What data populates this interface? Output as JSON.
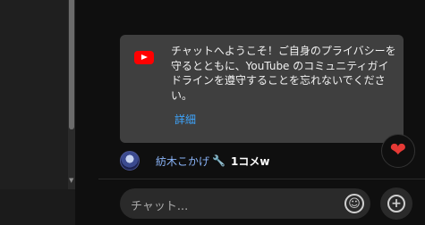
{
  "welcome": {
    "message": "チャットへようこそ！ご自身のプライバシーを守るとともに、YouTube のコミュニティガイドラインを遵守することを忘れないでください。",
    "details_link": "詳細"
  },
  "chat": {
    "messages": [
      {
        "author": "紡木こかげ",
        "text": "1コメw"
      }
    ]
  },
  "input": {
    "placeholder": "チャット..."
  },
  "icons": {
    "brand": "youtube-logo-icon",
    "reaction": "heart-icon",
    "emoji": "emoji-icon",
    "add": "add-icon",
    "moderator": "wrench-icon"
  },
  "colors": {
    "brand_red": "#ff0000",
    "link_blue": "#3ea6ff",
    "author_blue": "#8ab4f8",
    "heart_red": "#e53935"
  }
}
